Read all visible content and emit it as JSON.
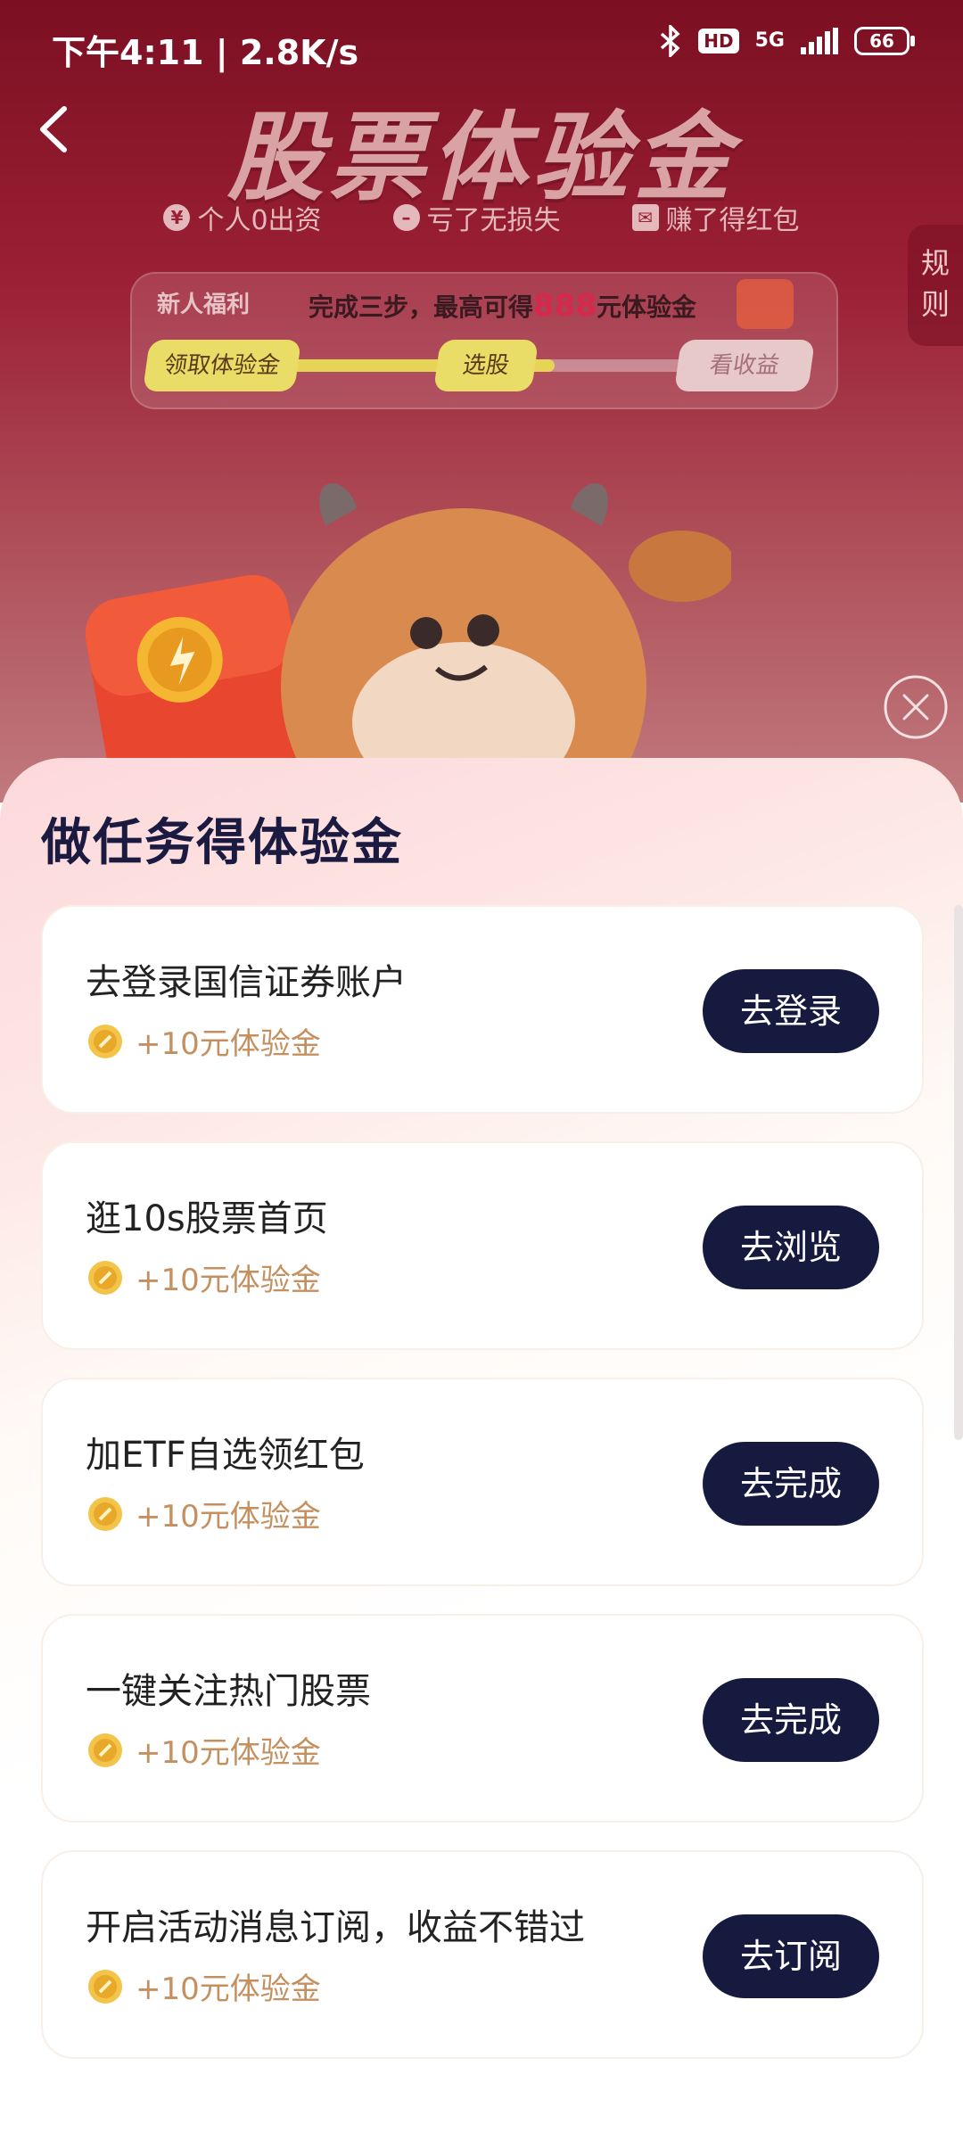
{
  "status_bar": {
    "time_speed": "下午4:11 | 2.8K/s",
    "network": "5G",
    "hd": "HD",
    "battery": "66"
  },
  "hero": {
    "title": "股票体验金",
    "perks": [
      {
        "icon": "yen-icon",
        "label": "个人0出资"
      },
      {
        "icon": "minus-icon",
        "label": "亏了无损失"
      },
      {
        "icon": "red-envelope-icon",
        "label": "赚了得红包"
      }
    ],
    "rules_label": "规则",
    "progress": {
      "newbie_label": "新人福利",
      "text_prefix": "完成三步，最高可得",
      "amount": "888",
      "text_suffix": "元体验金",
      "steps": [
        "领取体验金",
        "选股",
        "看收益"
      ],
      "completed_fraction": 0.62
    }
  },
  "sheet": {
    "title": "做任务得体验金",
    "tasks": [
      {
        "title": "去登录国信证券账户",
        "reward": "+10元体验金",
        "button": "去登录"
      },
      {
        "title": "逛10s股票首页",
        "reward": "+10元体验金",
        "button": "去浏览"
      },
      {
        "title": "加ETF自选领红包",
        "reward": "+10元体验金",
        "button": "去完成"
      },
      {
        "title": "一键关注热门股票",
        "reward": "+10元体验金",
        "button": "去完成"
      },
      {
        "title": "开启活动消息订阅，收益不错过",
        "reward": "+10元体验金",
        "button": "去订阅"
      }
    ]
  },
  "colors": {
    "hero_top": "#7c0f22",
    "accent_red": "#d6294b",
    "button_dark": "#171a3f",
    "reward_gold": "#c59060"
  }
}
